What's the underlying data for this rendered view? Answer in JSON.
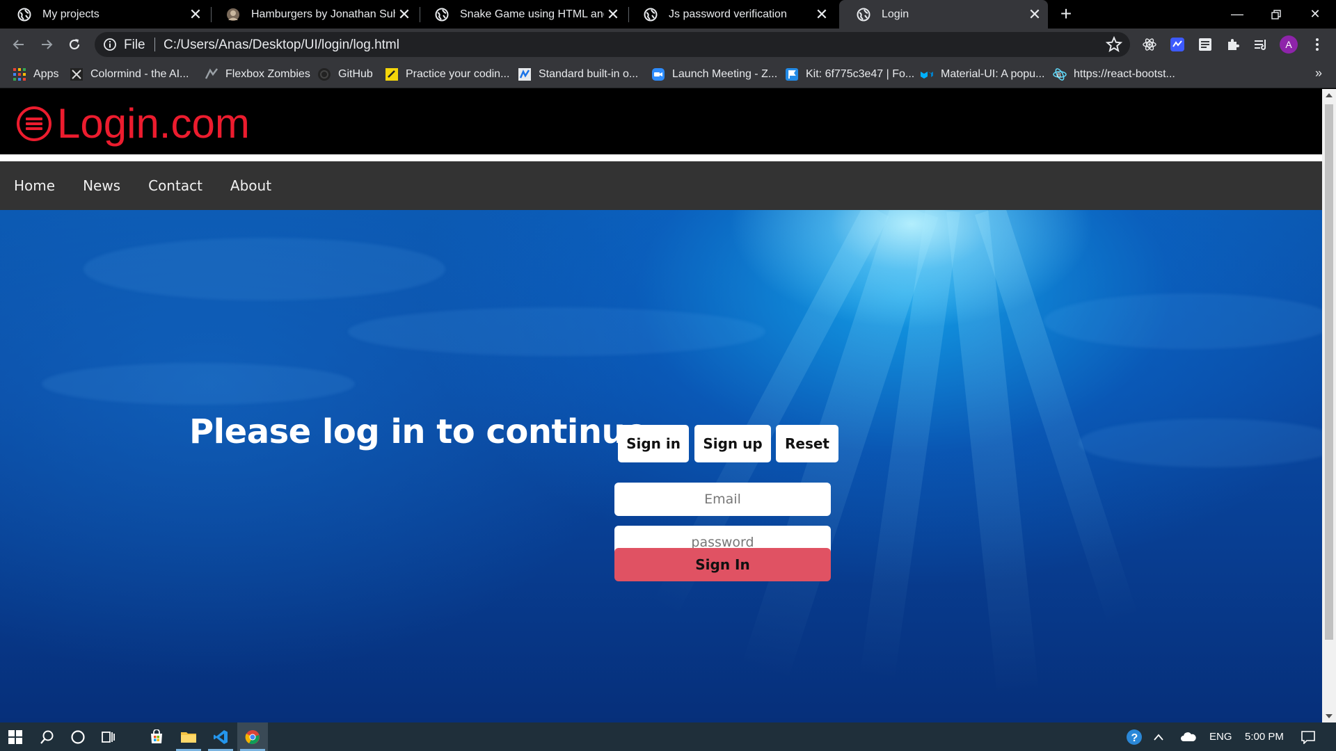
{
  "browser": {
    "tabs": [
      {
        "title": "My projects",
        "active": false
      },
      {
        "title": "Hamburgers by Jonathan Suh",
        "active": false
      },
      {
        "title": "Snake Game using HTML and Jav",
        "active": false
      },
      {
        "title": "Js password verification",
        "active": false
      },
      {
        "title": "Login",
        "active": true
      }
    ],
    "new_tab_label": "+",
    "address": {
      "scheme_label": "File",
      "url": "C:/Users/Anas/Desktop/UI/login/log.html"
    },
    "profile_initial": "A",
    "bookmarks": [
      {
        "label": "Apps",
        "icon": "apps-grid-icon"
      },
      {
        "label": "Colormind - the AI...",
        "icon": "colormind-icon"
      },
      {
        "label": "Flexbox Zombies",
        "icon": "flexbox-zombies-icon"
      },
      {
        "label": "GitHub",
        "icon": "github-icon"
      },
      {
        "label": "Practice your codin...",
        "icon": "codewars-icon"
      },
      {
        "label": "Standard built-in o...",
        "icon": "mdn-icon"
      },
      {
        "label": "Launch Meeting - Z...",
        "icon": "zoom-icon"
      },
      {
        "label": "Kit: 6f775c3e47 | Fo...",
        "icon": "fontawesome-flag-icon"
      },
      {
        "label": "Material-UI: A popu...",
        "icon": "material-ui-icon"
      },
      {
        "label": "https://react-bootst...",
        "icon": "react-bootstrap-icon"
      }
    ]
  },
  "site": {
    "logo_text": "Login.com",
    "brand_color": "#ec1c2e",
    "nav": [
      "Home",
      "News",
      "Contact",
      "About"
    ],
    "heading": "Please log in to continue...",
    "tab_buttons": [
      "Sign in",
      "Sign up",
      "Reset"
    ],
    "email_placeholder": "Email",
    "password_placeholder": "password",
    "submit_label": "Sign In",
    "submit_color": "#e05263"
  },
  "taskbar": {
    "language": "ENG",
    "time": "5:00 PM"
  }
}
